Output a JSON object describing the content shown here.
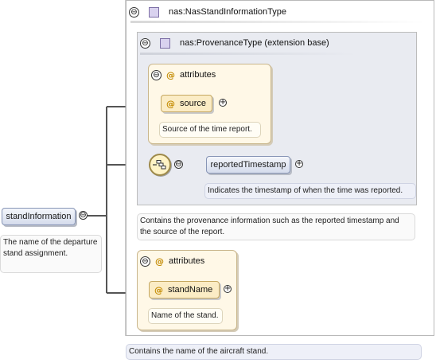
{
  "diagram": {
    "root_element": {
      "name": "standInformation",
      "documentation": "The name of the departure stand assignment."
    },
    "outer_type": {
      "name": "nas:NasStandInformationType",
      "documentation": "Contains the name of the aircraft stand."
    },
    "provenance_type": {
      "name": "nas:ProvenanceType (extension base)",
      "documentation": "Contains the provenance information such as the reported timestamp and the source of the report."
    },
    "provenance_attributes": {
      "label": "attributes",
      "attribute": {
        "name": "source",
        "documentation": "Source of the time report."
      }
    },
    "reported_timestamp": {
      "name": "reportedTimestamp",
      "documentation": "Indicates the timestamp of when the time was reported."
    },
    "stand_attributes": {
      "label": "attributes",
      "attribute": {
        "name": "standName",
        "documentation": "Name of the stand."
      }
    },
    "symbols": {
      "collapse": "⊖",
      "expand": "+",
      "attribute": "@"
    },
    "colors": {
      "type_icon": "#d9d2ef",
      "attribute_node": "#fbecc5",
      "attribute_group": "#fff8e7",
      "element_node": "#d5dcec",
      "connector": "#555555"
    }
  }
}
